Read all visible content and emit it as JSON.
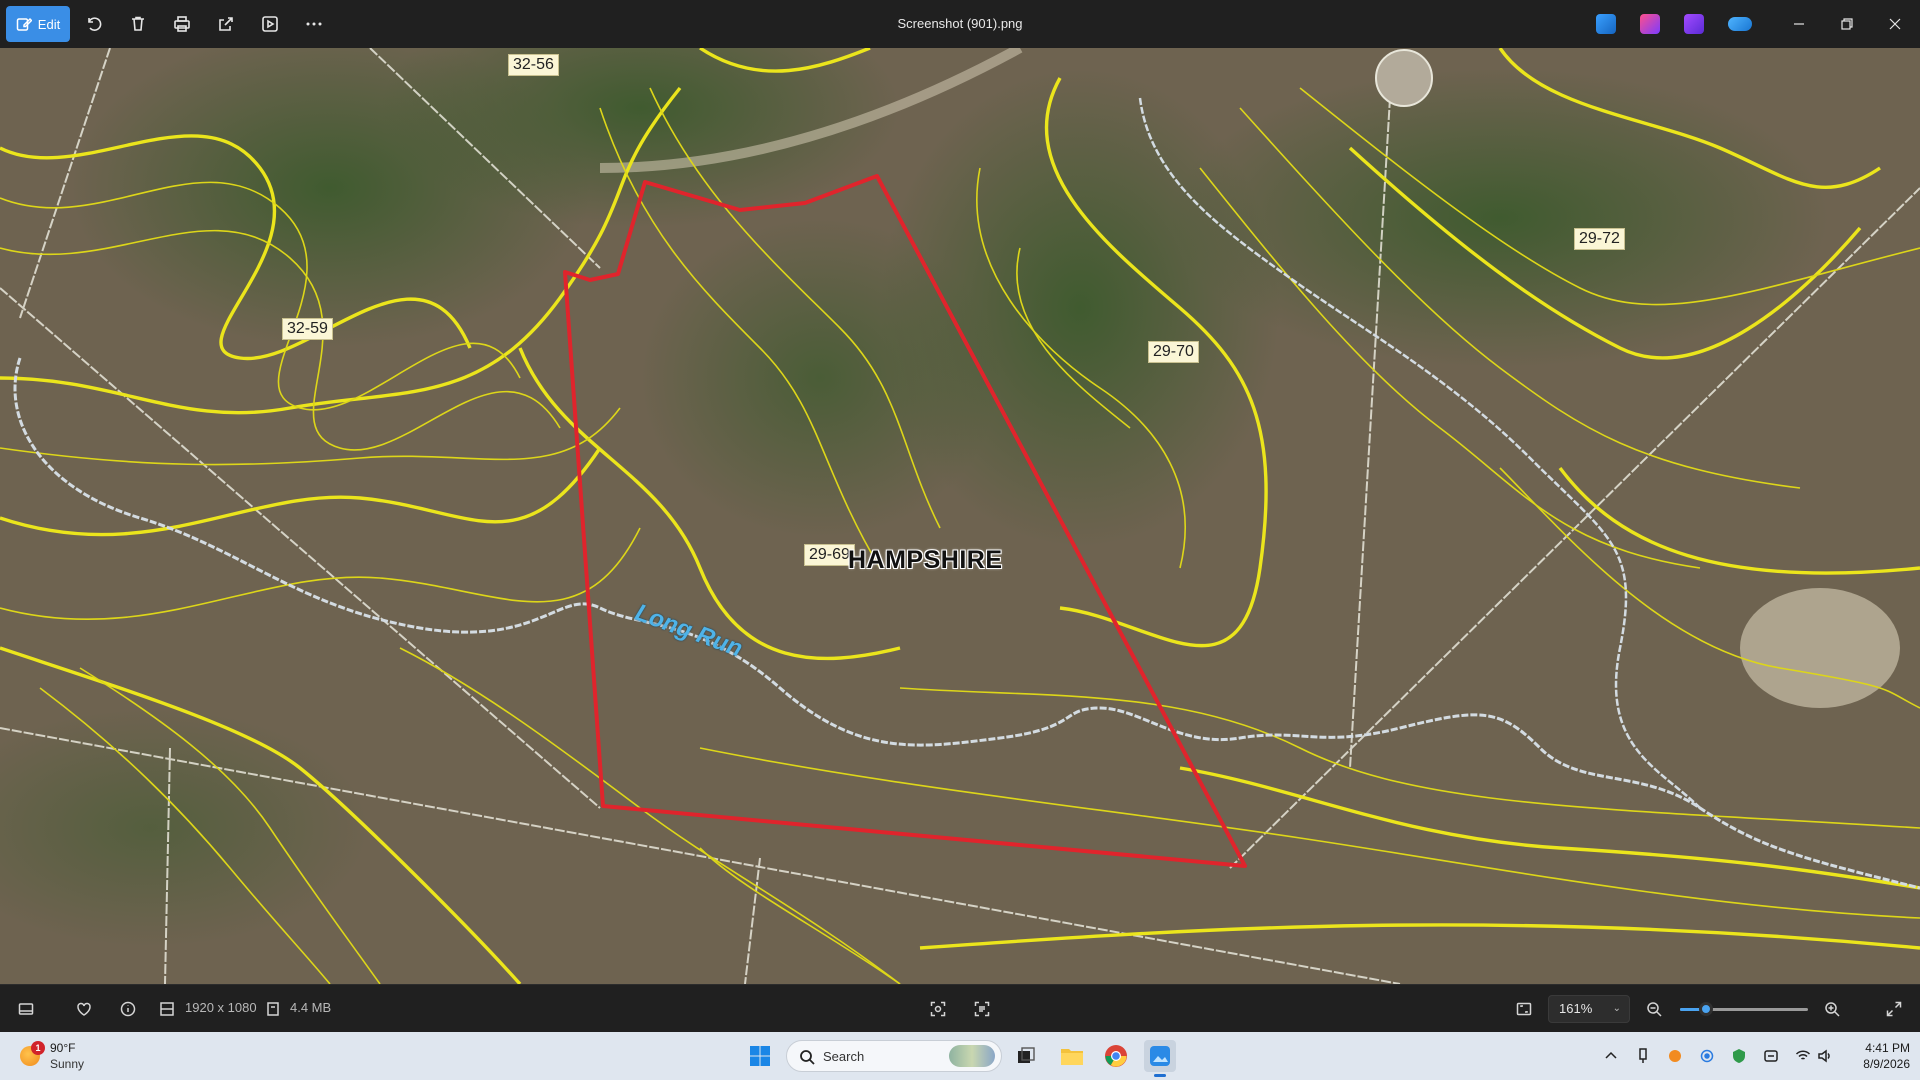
{
  "window": {
    "title": "Screenshot (901).png",
    "edit_label": "Edit"
  },
  "toolbar": {
    "tools": [
      "rotate-icon",
      "delete-icon",
      "print-icon",
      "share-icon",
      "slideshow-icon",
      "more-icon"
    ],
    "app_icons": [
      "clipchamp-icon",
      "designer-icon",
      "clipchamp-video-icon",
      "onedrive-icon"
    ]
  },
  "map": {
    "parcel_labels": [
      "32-56",
      "32-59",
      "29-72",
      "29-70",
      "29-69"
    ],
    "region_label": "HAMPSHIRE",
    "stream_label": "Long Run",
    "colors": {
      "boundary": "#e0242c",
      "contour": "#e6e21a",
      "stream": "#d7dde3",
      "terrain": "#6f6450",
      "forest": "#3f5b2e"
    }
  },
  "viewbar": {
    "dimensions": "1920 x 1080",
    "file_size": "4.4 MB",
    "zoom": "161%",
    "zoom_level_fraction": 0.2
  },
  "taskbar": {
    "weather_temp": "90°F",
    "weather_condition": "Sunny",
    "weather_badge": "1",
    "search_label": "Search",
    "time": "4:41 PM",
    "date": "8/9/2026"
  }
}
